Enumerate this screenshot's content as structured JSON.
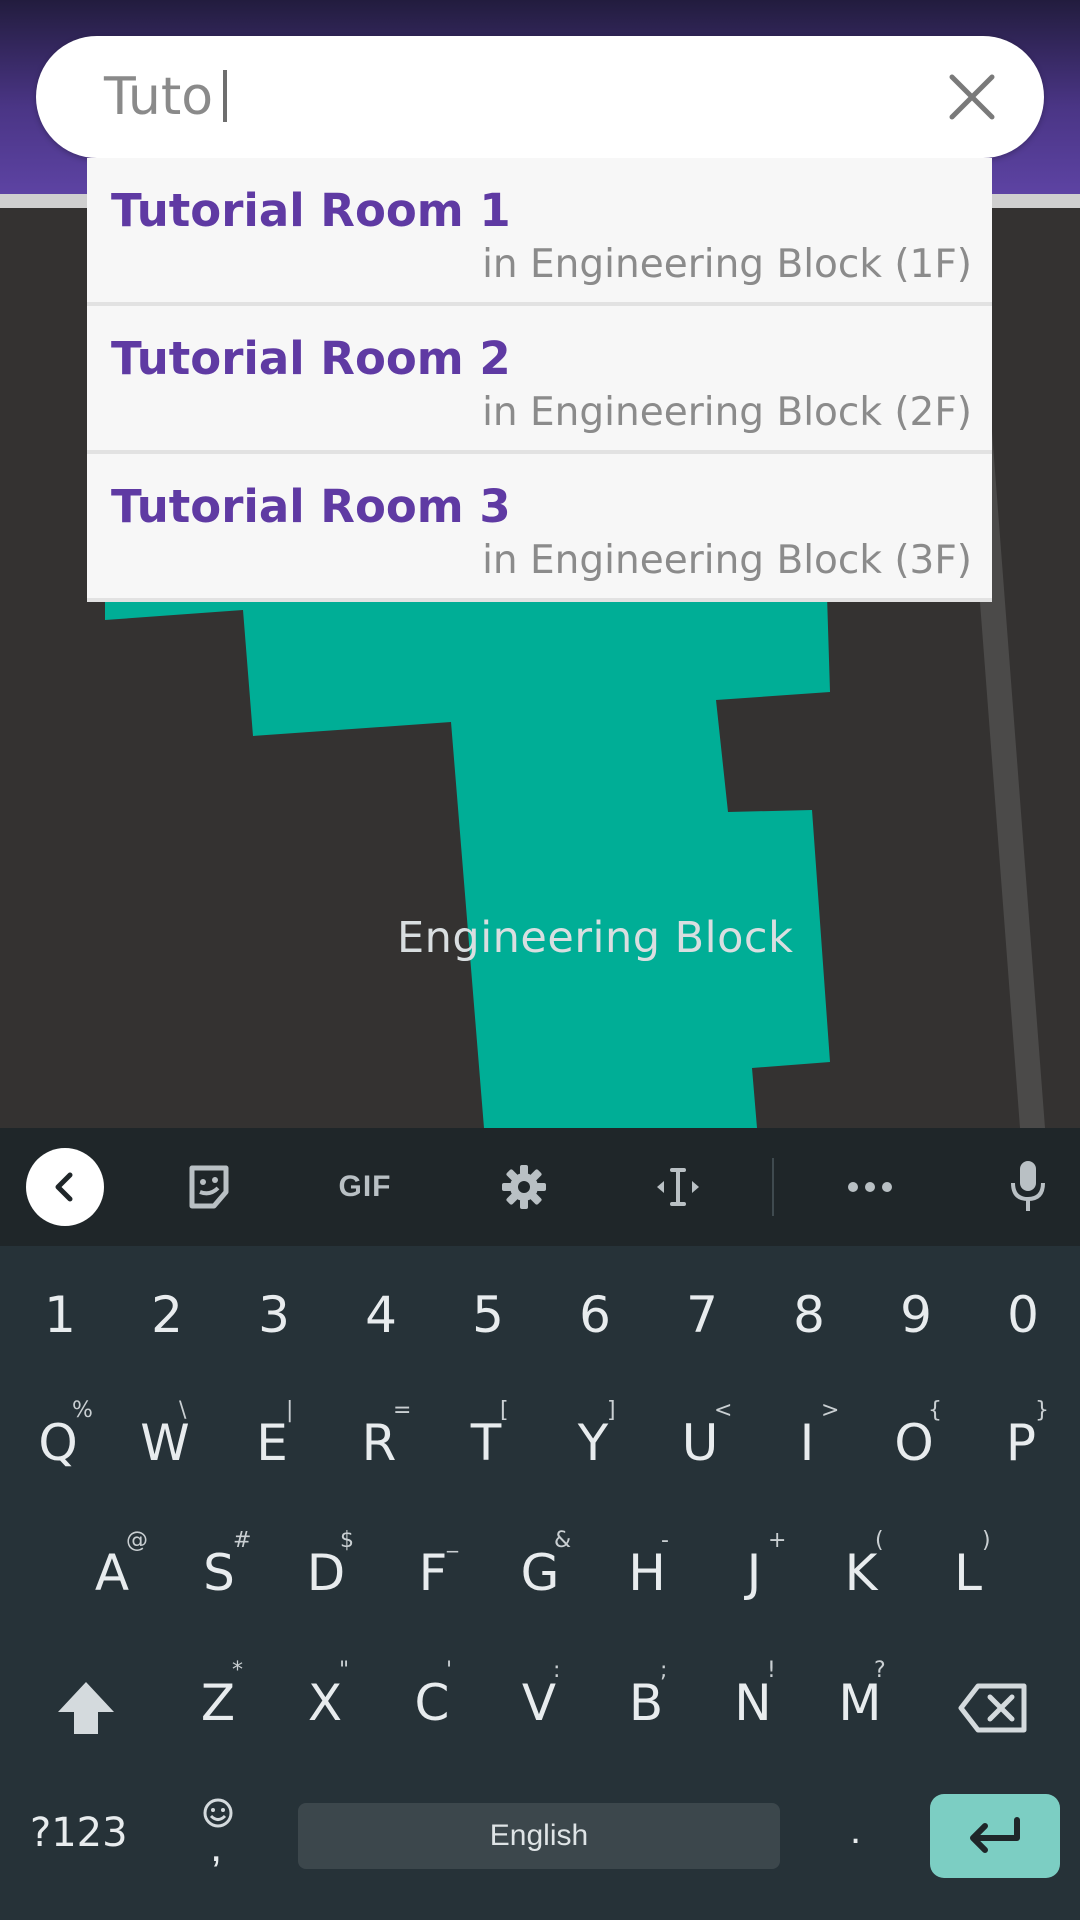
{
  "search": {
    "value": "Tuto",
    "clear_icon": "close-icon"
  },
  "suggestions": [
    {
      "title": "Tutorial Room 1",
      "subtitle": "in Engineering Block (1F)"
    },
    {
      "title": "Tutorial Room 2",
      "subtitle": "in Engineering Block (2F)"
    },
    {
      "title": "Tutorial Room 3",
      "subtitle": "in Engineering Block (3F)"
    }
  ],
  "map": {
    "building_label": "Engineering Block",
    "building_color": "#00ae96",
    "background_color": "#343231"
  },
  "colors": {
    "accent": "#5f3aa3",
    "header": "#5d43a3",
    "keyboard_bg": "#263238",
    "enter_key": "#7ccec3"
  },
  "keyboard": {
    "toolbar": {
      "back_icon": "chevron-left-icon",
      "sticker_icon": "sticker-icon",
      "gif_label": "GIF",
      "settings_icon": "gear-icon",
      "cursor_icon": "text-cursor-icon",
      "more_icon": "more-dots-icon",
      "mic_icon": "microphone-icon"
    },
    "number_row": [
      "1",
      "2",
      "3",
      "4",
      "5",
      "6",
      "7",
      "8",
      "9",
      "0"
    ],
    "row1": [
      {
        "key": "Q",
        "hint": "%"
      },
      {
        "key": "W",
        "hint": "\\"
      },
      {
        "key": "E",
        "hint": "|"
      },
      {
        "key": "R",
        "hint": "="
      },
      {
        "key": "T",
        "hint": "["
      },
      {
        "key": "Y",
        "hint": "]"
      },
      {
        "key": "U",
        "hint": "<"
      },
      {
        "key": "I",
        "hint": ">"
      },
      {
        "key": "O",
        "hint": "{"
      },
      {
        "key": "P",
        "hint": "}"
      }
    ],
    "row2": [
      {
        "key": "A",
        "hint": "@"
      },
      {
        "key": "S",
        "hint": "#"
      },
      {
        "key": "D",
        "hint": "$"
      },
      {
        "key": "F",
        "hint": "_"
      },
      {
        "key": "G",
        "hint": "&"
      },
      {
        "key": "H",
        "hint": "-"
      },
      {
        "key": "J",
        "hint": "+"
      },
      {
        "key": "K",
        "hint": "("
      },
      {
        "key": "L",
        "hint": ")"
      }
    ],
    "row3": [
      {
        "key": "Z",
        "hint": "*"
      },
      {
        "key": "X",
        "hint": "\""
      },
      {
        "key": "C",
        "hint": "'"
      },
      {
        "key": "V",
        "hint": ":"
      },
      {
        "key": "B",
        "hint": ";"
      },
      {
        "key": "N",
        "hint": "!"
      },
      {
        "key": "M",
        "hint": "?"
      }
    ],
    "symbols_label": "?123",
    "emoji_comma_label": ",",
    "space_label": "English",
    "period_label": ".",
    "shift_icon": "shift-icon",
    "backspace_icon": "backspace-icon",
    "enter_icon": "enter-icon"
  }
}
